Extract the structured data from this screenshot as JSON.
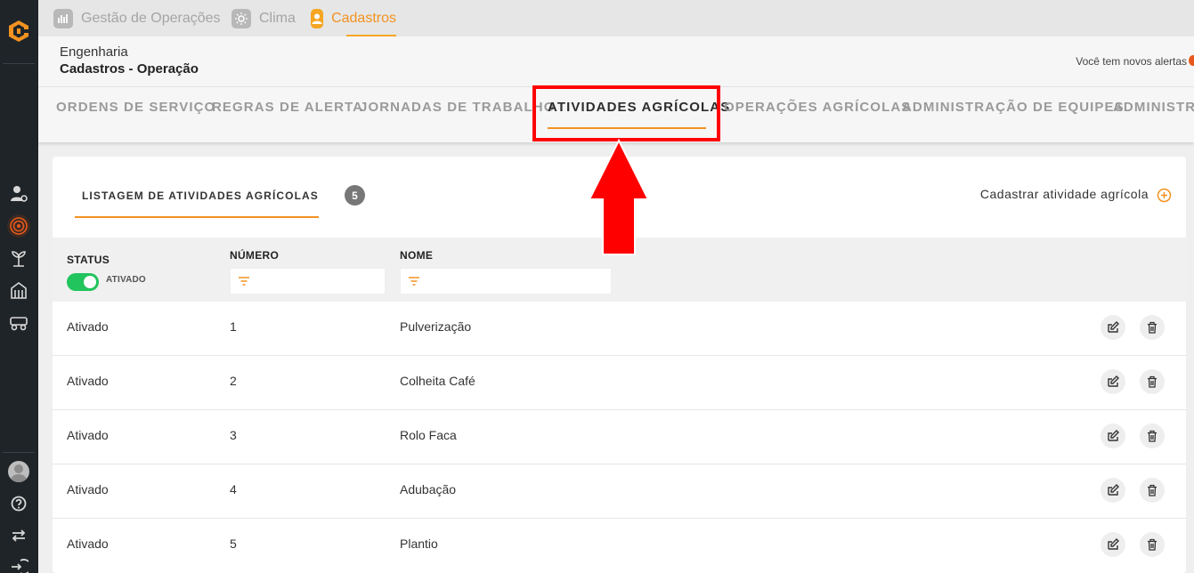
{
  "app_tabs": [
    {
      "label": "Gestão de Operações",
      "icon": "chart-icon"
    },
    {
      "label": "Clima",
      "icon": "sun-icon"
    },
    {
      "label": "Cadastros",
      "icon": "user-icon",
      "active": true
    }
  ],
  "header": {
    "company": "Engenharia",
    "page_title": "Cadastros - Operação",
    "alerts_text": "Você tem novos alertas"
  },
  "section_tabs": [
    {
      "label": "ORDENS DE SERVIÇO"
    },
    {
      "label": "REGRAS DE ALERTA"
    },
    {
      "label": "JORNADAS DE TRABALHO"
    },
    {
      "label": "ATIVIDADES AGRÍCOLAS",
      "active": true
    },
    {
      "label": "OPERAÇÕES AGRÍCOLAS"
    },
    {
      "label": "ADMINISTRAÇÃO DE EQUIPES"
    },
    {
      "label": "ADMINISTR"
    }
  ],
  "card": {
    "list_tab_label": "LISTAGEM DE ATIVIDADES AGRÍCOLAS",
    "count": "5",
    "add_label": "Cadastrar atividade agrícola"
  },
  "table": {
    "columns": {
      "status": "STATUS",
      "numero": "NÚMERO",
      "nome": "NOME"
    },
    "status_filter_label": "ATIVADO",
    "rows": [
      {
        "status": "Ativado",
        "numero": "1",
        "nome": "Pulverização"
      },
      {
        "status": "Ativado",
        "numero": "2",
        "nome": "Colheita Café"
      },
      {
        "status": "Ativado",
        "numero": "3",
        "nome": "Rolo Faca"
      },
      {
        "status": "Ativado",
        "numero": "4",
        "nome": "Adubação"
      },
      {
        "status": "Ativado",
        "numero": "5",
        "nome": "Plantio"
      }
    ]
  },
  "colors": {
    "accent": "#f29221",
    "sidebar": "#1f2428",
    "toggle_on": "#21c45d",
    "annotation": "#ff0000"
  }
}
